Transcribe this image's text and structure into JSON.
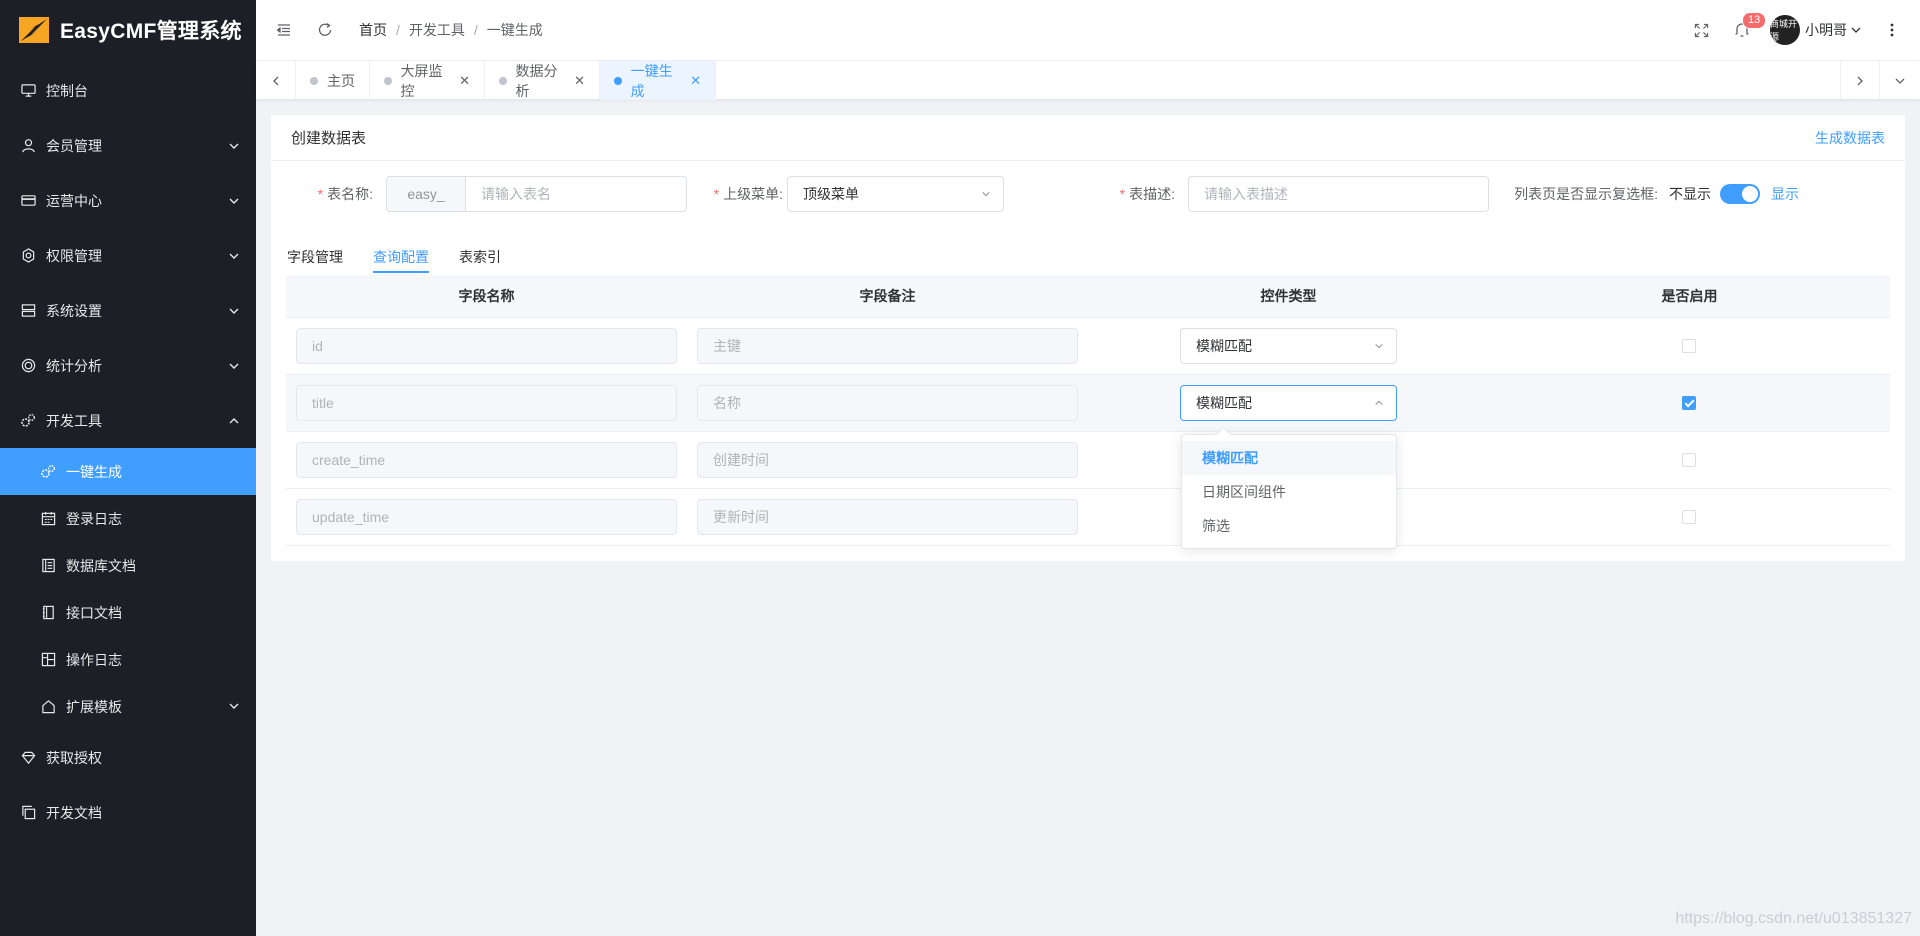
{
  "app": {
    "title": "EasyCMF管理系统"
  },
  "sidebar": {
    "items": [
      {
        "label": "控制台",
        "icon": "monitor-icon"
      },
      {
        "label": "会员管理",
        "icon": "user-icon"
      },
      {
        "label": "运营中心",
        "icon": "credit-card-icon"
      },
      {
        "label": "权限管理",
        "icon": "settings-icon"
      },
      {
        "label": "系统设置",
        "icon": "server-icon"
      },
      {
        "label": "统计分析",
        "icon": "chart-icon"
      },
      {
        "label": "开发工具",
        "icon": "gears-icon"
      }
    ],
    "dev_sub": [
      {
        "label": "一键生成",
        "icon": "gears-icon"
      },
      {
        "label": "登录日志",
        "icon": "calendar-icon"
      },
      {
        "label": "数据库文档",
        "icon": "document-icon"
      },
      {
        "label": "接口文档",
        "icon": "notebook-icon"
      },
      {
        "label": "操作日志",
        "icon": "layout-icon"
      },
      {
        "label": "扩展模板",
        "icon": "house-icon"
      }
    ],
    "bottom": [
      {
        "label": "获取授权",
        "icon": "diamond-icon"
      },
      {
        "label": "开发文档",
        "icon": "copy-icon"
      }
    ]
  },
  "header": {
    "breadcrumb": [
      "首页",
      "开发工具",
      "一键生成"
    ],
    "notification_count": "13",
    "avatar_text": "商城开源",
    "username": "小明哥"
  },
  "tabs": [
    "主页",
    "大屏监控",
    "数据分析",
    "一键生成"
  ],
  "card": {
    "title": "创建数据表",
    "action": "生成数据表",
    "form": {
      "table_name_label": "表名称:",
      "table_prefix": "easy_",
      "table_name_placeholder": "请输入表名",
      "parent_menu_label": "上级菜单:",
      "parent_menu_value": "顶级菜单",
      "table_desc_label": "表描述:",
      "table_desc_placeholder": "请输入表描述",
      "checkbox_label": "列表页是否显示复选框:",
      "switch_off": "不显示",
      "switch_on": "显示"
    },
    "subtabs": [
      "字段管理",
      "查询配置",
      "表索引"
    ],
    "table": {
      "headers": [
        "字段名称",
        "字段备注",
        "控件类型",
        "是否启用"
      ],
      "rows": [
        {
          "name": "id",
          "remark": "主键",
          "control": "模糊匹配",
          "enabled": false
        },
        {
          "name": "title",
          "remark": "名称",
          "control": "模糊匹配",
          "enabled": true
        },
        {
          "name": "create_time",
          "remark": "创建时间",
          "control": "",
          "enabled": false
        },
        {
          "name": "update_time",
          "remark": "更新时间",
          "control": "",
          "enabled": false
        }
      ]
    },
    "dropdown_options": [
      "模糊匹配",
      "日期区间组件",
      "筛选"
    ]
  },
  "watermark": "https://blog.csdn.net/u013851327",
  "colors": {
    "primary": "#409eff",
    "sidebar": "#1d1e26",
    "danger": "#f56c6c"
  }
}
